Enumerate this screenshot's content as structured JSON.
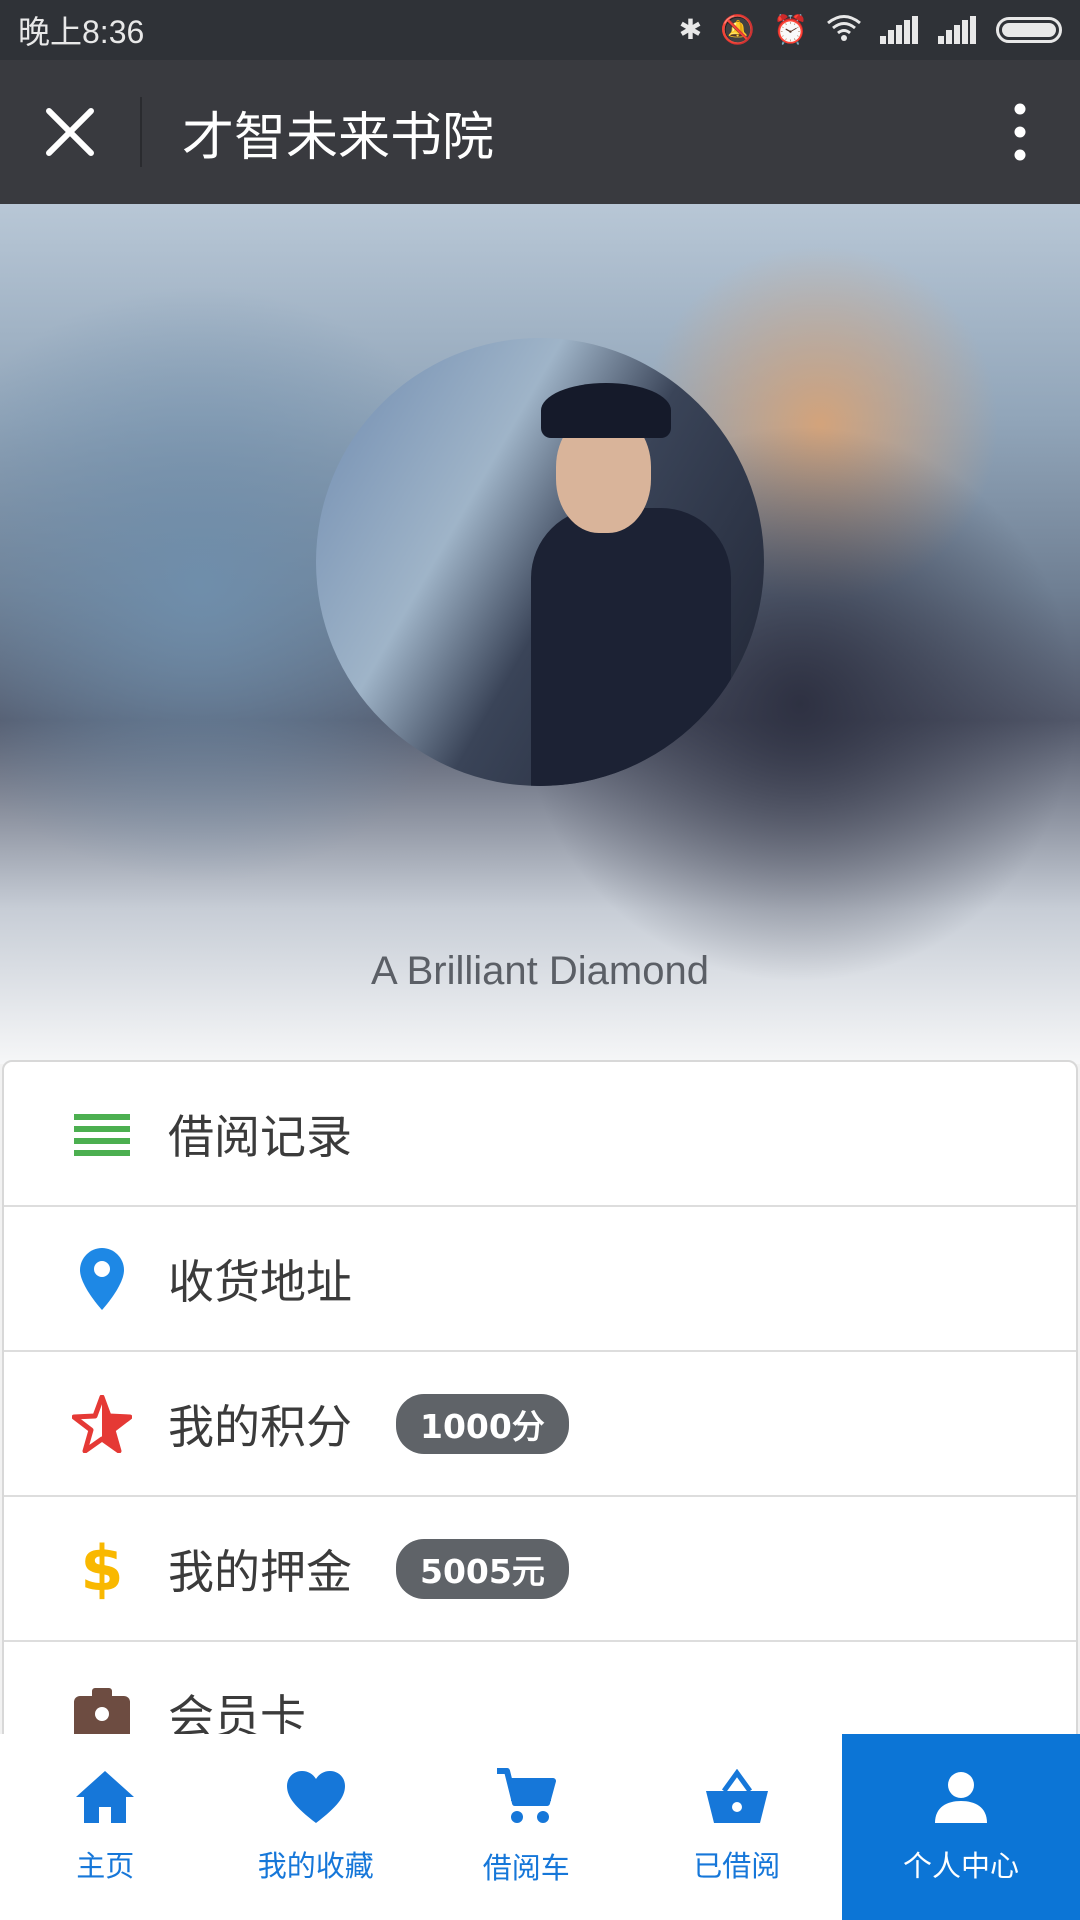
{
  "status_bar": {
    "time": "晚上8:36"
  },
  "app_bar": {
    "title": "才智未来书院"
  },
  "profile": {
    "name": "A Brilliant Diamond"
  },
  "menu": [
    {
      "label": "借阅记录",
      "icon": "list-icon",
      "icon_color": "#4caf50"
    },
    {
      "label": "收货地址",
      "icon": "location-pin-icon",
      "icon_color": "#1e88e5"
    },
    {
      "label": "我的积分",
      "icon": "star-icon",
      "icon_color": "#e53935",
      "badge": "1000分"
    },
    {
      "label": "我的押金",
      "icon": "dollar-icon",
      "icon_color": "#f9b800",
      "badge": "5005元"
    },
    {
      "label": "会员卡",
      "icon": "id-card-icon",
      "icon_color": "#6d4c41"
    }
  ],
  "bottom_nav": [
    {
      "label": "主页",
      "icon": "home-icon"
    },
    {
      "label": "我的收藏",
      "icon": "heart-icon"
    },
    {
      "label": "借阅车",
      "icon": "cart-icon"
    },
    {
      "label": "已借阅",
      "icon": "basket-icon"
    },
    {
      "label": "个人中心",
      "icon": "person-icon",
      "active": true
    }
  ],
  "colors": {
    "accent": "#0c75d6",
    "app_bar": "#393a3f",
    "status_bar": "#2f3237"
  }
}
